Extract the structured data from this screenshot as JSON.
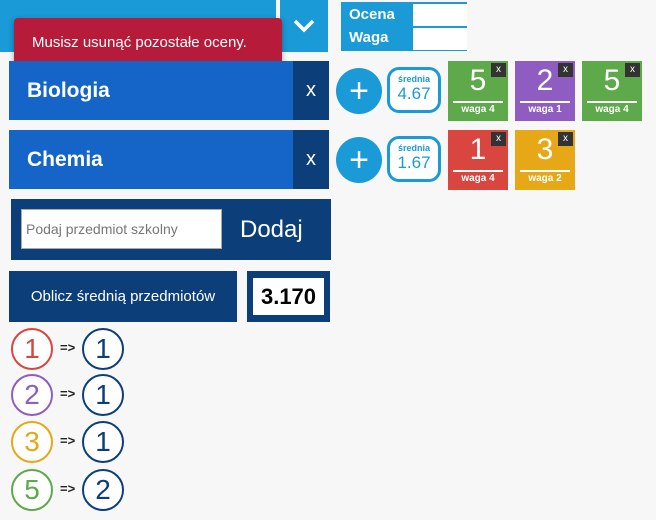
{
  "rating_panel": {
    "ocena_label": "Ocena",
    "waga_label": "Waga"
  },
  "toast": {
    "message": "Musisz usunąć pozostałe oceny."
  },
  "subjects": [
    {
      "name": "Biologia",
      "remove_label": "x",
      "add_label": "+",
      "average_label": "średnia",
      "average": "4.67",
      "grades": [
        {
          "value": "5",
          "weight": "waga 4",
          "color": "#5ea94a",
          "remove": "x"
        },
        {
          "value": "2",
          "weight": "waga 1",
          "color": "#8f5cc2",
          "remove": "x"
        },
        {
          "value": "5",
          "weight": "waga 4",
          "color": "#5ea94a",
          "remove": "x"
        }
      ]
    },
    {
      "name": "Chemia",
      "remove_label": "x",
      "add_label": "+",
      "average_label": "średnia",
      "average": "1.67",
      "grades": [
        {
          "value": "1",
          "weight": "waga 4",
          "color": "#d9453f",
          "remove": "x"
        },
        {
          "value": "3",
          "weight": "waga 2",
          "color": "#e6a816",
          "remove": "x"
        }
      ]
    }
  ],
  "add_subject": {
    "placeholder": "Podaj przedmiot szkolny",
    "button_label": "Dodaj"
  },
  "calculate": {
    "button_label": "Oblicz średnią przedmiotów",
    "result": "3.170"
  },
  "conversions": [
    {
      "grade": "1",
      "color": "#d9453f",
      "arrow": "=>",
      "count": "1"
    },
    {
      "grade": "2",
      "color": "#8f5cc2",
      "arrow": "=>",
      "count": "1"
    },
    {
      "grade": "3",
      "color": "#e6a816",
      "arrow": "=>",
      "count": "1"
    },
    {
      "grade": "5",
      "color": "#5ea94a",
      "arrow": "=>",
      "count": "2"
    }
  ],
  "colors": {
    "primary_blue": "#1565c8",
    "light_blue": "#1a9ad6",
    "dark_navy": "#0c3f7a",
    "toast_red": "#b61c3a"
  },
  "icons": {
    "dropdown": "chevron-down-icon"
  }
}
